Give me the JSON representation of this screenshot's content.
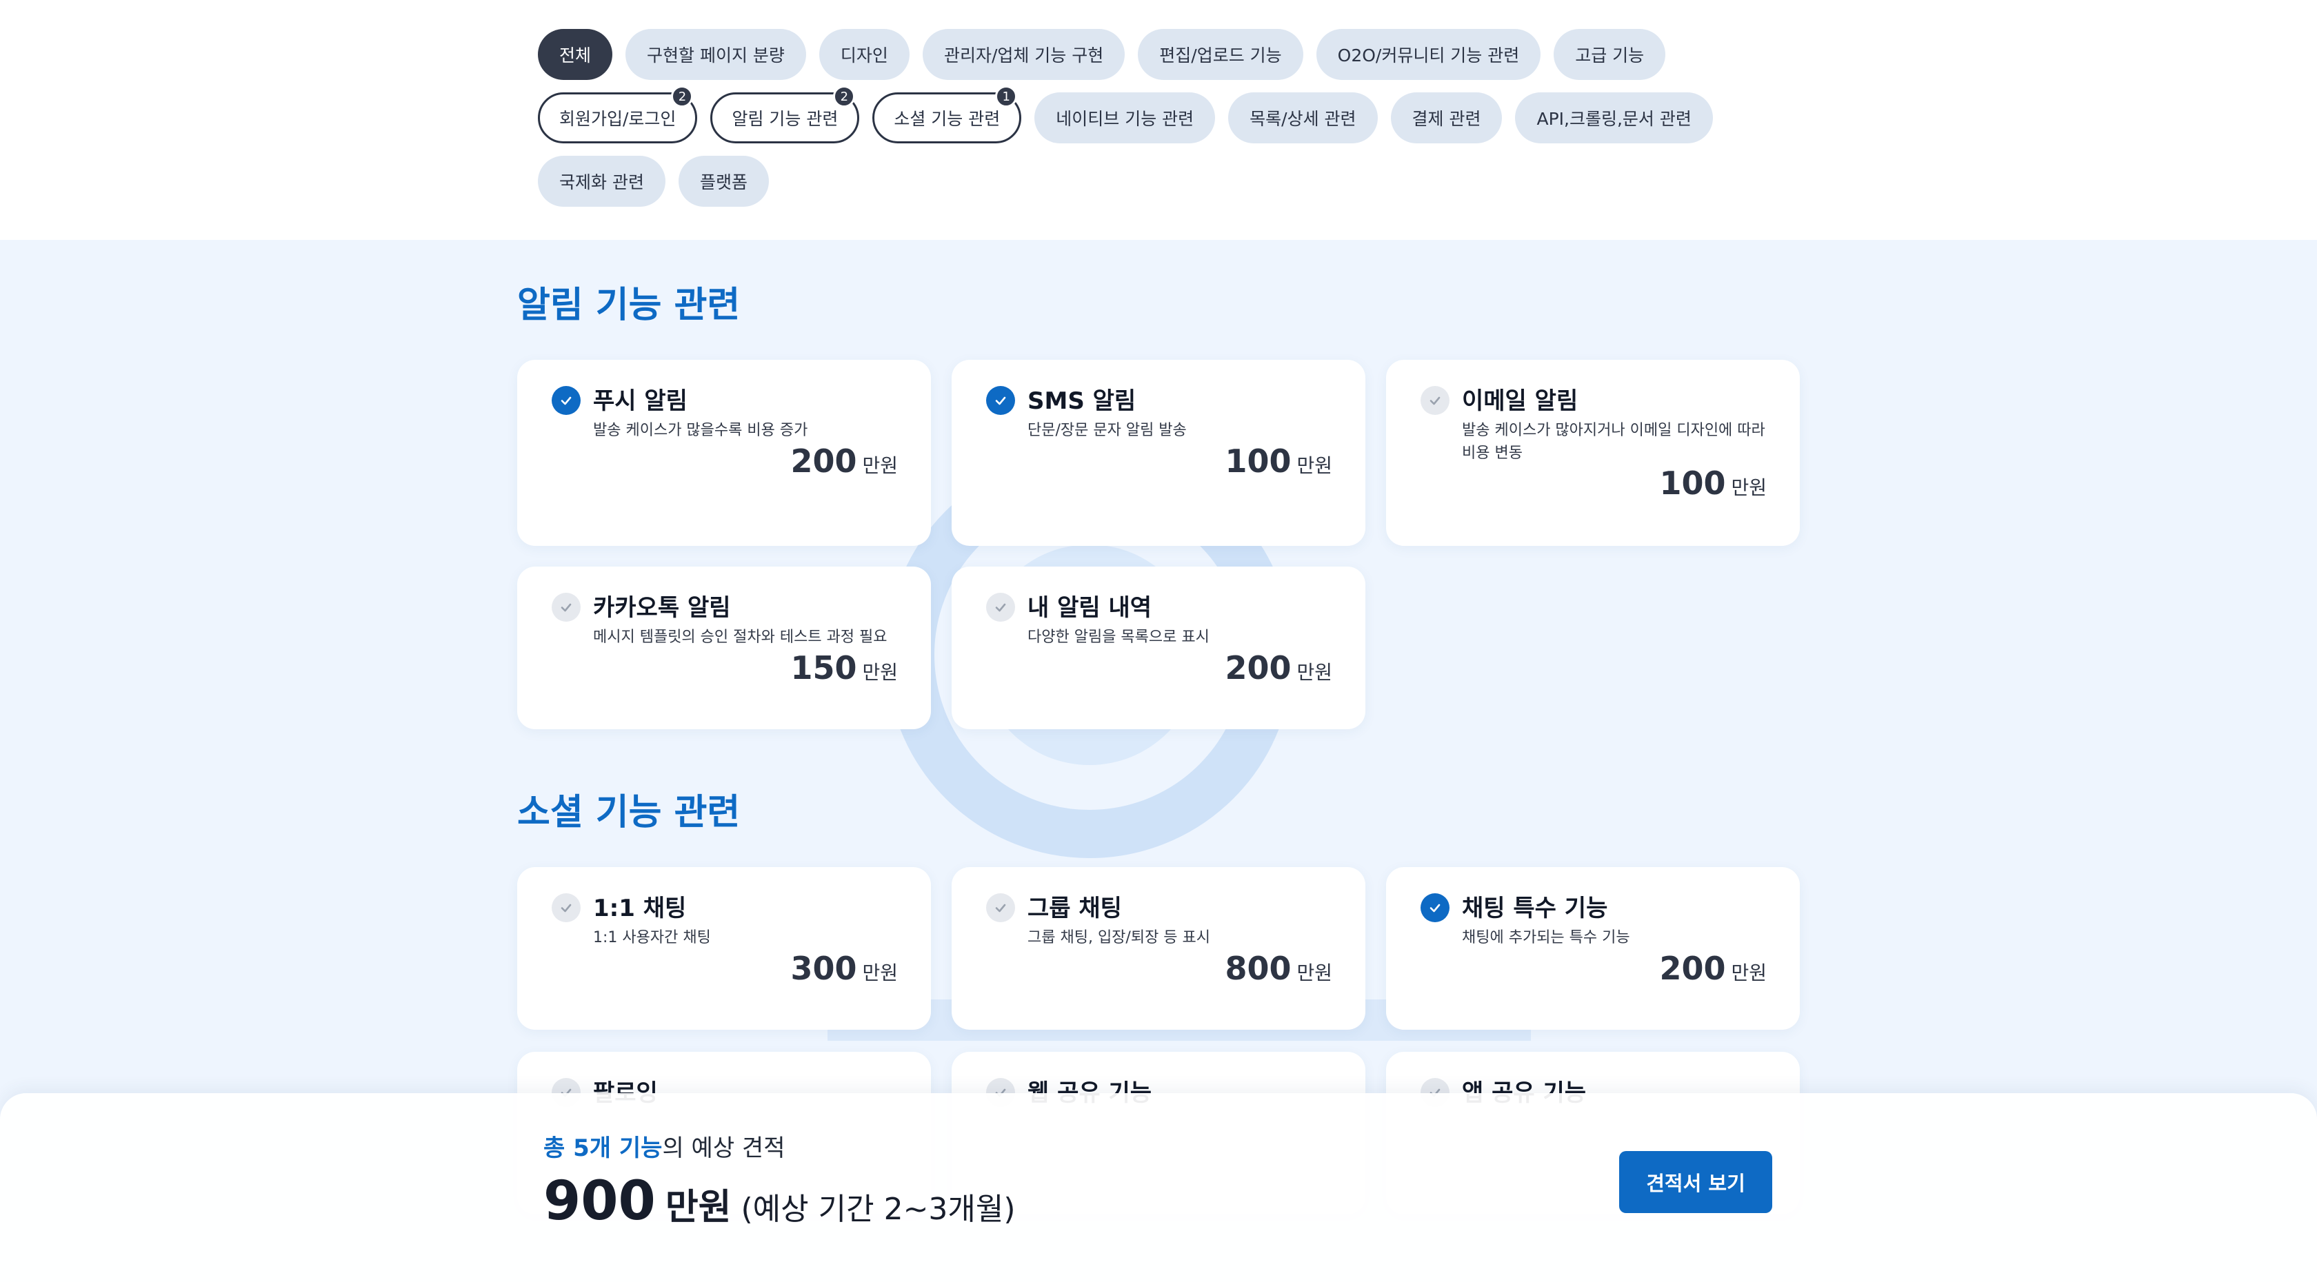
{
  "filters": {
    "chips": [
      {
        "label": "전체",
        "state": "active"
      },
      {
        "label": "구현할 페이지 분량",
        "state": "default"
      },
      {
        "label": "디자인",
        "state": "default"
      },
      {
        "label": "관리자/업체 기능 구현",
        "state": "default"
      },
      {
        "label": "편집/업로드 기능",
        "state": "default"
      },
      {
        "label": "O2O/커뮤니티 기능 관련",
        "state": "default"
      },
      {
        "label": "고급 기능",
        "state": "default"
      },
      {
        "label": "회원가입/로그인",
        "state": "outlined",
        "count": "2"
      },
      {
        "label": "알림 기능 관련",
        "state": "outlined",
        "count": "2"
      },
      {
        "label": "소셜 기능 관련",
        "state": "outlined",
        "count": "1"
      },
      {
        "label": "네이티브 기능 관련",
        "state": "default"
      },
      {
        "label": "목록/상세 관련",
        "state": "default"
      },
      {
        "label": "결제 관련",
        "state": "default"
      },
      {
        "label": "API,크롤링,문서 관련",
        "state": "default"
      },
      {
        "label": "국제화 관련",
        "state": "default"
      },
      {
        "label": "플랫폼",
        "state": "default"
      }
    ]
  },
  "sections": [
    {
      "title": "알림 기능 관련",
      "items": [
        {
          "name": "푸시 알림",
          "desc": "발송 케이스가 많을수록 비용 증가",
          "price": "200",
          "unit": "만원",
          "selected": true
        },
        {
          "name": "SMS 알림",
          "desc": "단문/장문 문자 알림 발송",
          "price": "100",
          "unit": "만원",
          "selected": true
        },
        {
          "name": "이메일 알림",
          "desc": "발송 케이스가 많아지거나 이메일 디자인에 따라 비용 변동",
          "price": "100",
          "unit": "만원",
          "selected": false
        },
        {
          "name": "카카오톡 알림",
          "desc": "메시지 템플릿의 승인 절차와 테스트 과정 필요",
          "price": "150",
          "unit": "만원",
          "selected": false
        },
        {
          "name": "내 알림 내역",
          "desc": "다양한 알림을 목록으로 표시",
          "price": "200",
          "unit": "만원",
          "selected": false
        }
      ]
    },
    {
      "title": "소셜 기능 관련",
      "items": [
        {
          "name": "1:1 채팅",
          "desc": "1:1 사용자간 채팅",
          "price": "300",
          "unit": "만원",
          "selected": false
        },
        {
          "name": "그룹 채팅",
          "desc": "그룹 채팅, 입장/퇴장 등 표시",
          "price": "800",
          "unit": "만원",
          "selected": false
        },
        {
          "name": "채팅 특수 기능",
          "desc": "채팅에 추가되는 특수 기능",
          "price": "200",
          "unit": "만원",
          "selected": true
        },
        {
          "name": "팔로잉",
          "desc": "",
          "price": "",
          "unit": "",
          "selected": false
        },
        {
          "name": "웹 공유 기능",
          "desc": "",
          "price": "",
          "unit": "",
          "selected": false
        },
        {
          "name": "앱 공유 기능",
          "desc": "",
          "price": "",
          "unit": "",
          "selected": false
        }
      ]
    }
  ],
  "estimate": {
    "prefix": "총 ",
    "count": "5개 기능",
    "suffix": "의 예상 견적",
    "total": "900",
    "unit": "만원",
    "period": "(예상 기간 2~3개월)",
    "button": "견적서 보기"
  },
  "colors": {
    "accent": "#0e6ac4",
    "chip_active": "#333a4a",
    "background": "#eef5fe"
  }
}
